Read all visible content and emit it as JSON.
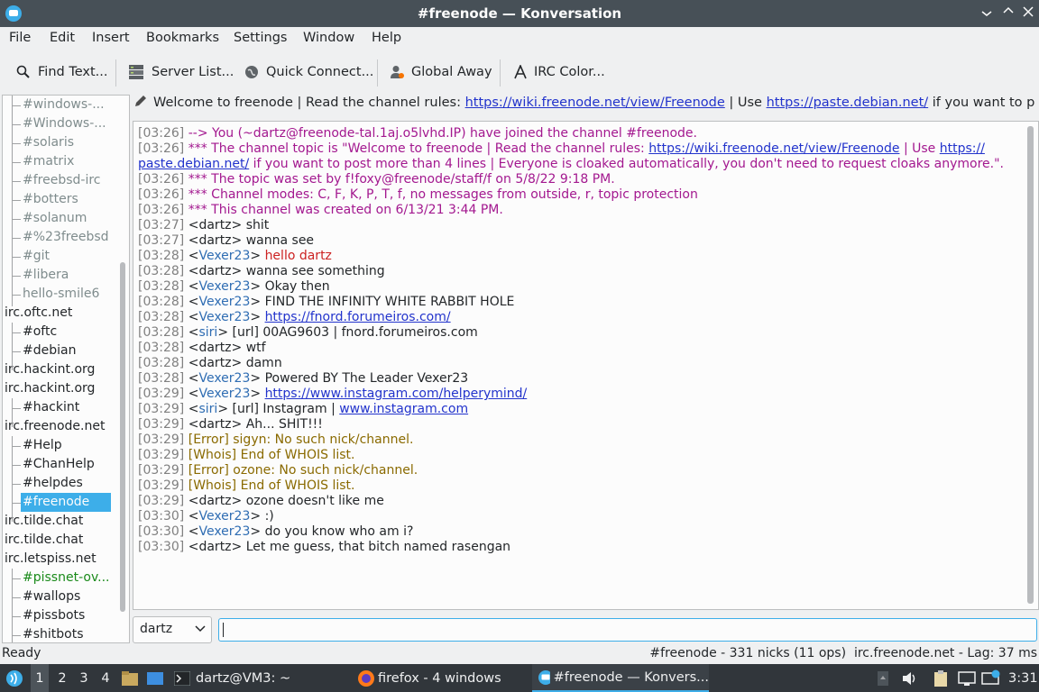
{
  "window": {
    "title": "#freenode — Konversation"
  },
  "menu": [
    "File",
    "Edit",
    "Insert",
    "Bookmarks",
    "Settings",
    "Window",
    "Help"
  ],
  "toolbar": {
    "find": "Find Text...",
    "server_list": "Server List...",
    "quick_connect": "Quick Connect...",
    "global_away": "Global Away",
    "irc_color": "IRC Color..."
  },
  "tree": [
    {
      "label": "#windows-...",
      "type": "channel",
      "color": "#7f8c8d"
    },
    {
      "label": "#Windows-...",
      "type": "channel",
      "color": "#7f8c8d"
    },
    {
      "label": "#solaris",
      "type": "channel",
      "color": "#7f8c8d"
    },
    {
      "label": "#matrix",
      "type": "channel",
      "color": "#7f8c8d"
    },
    {
      "label": "#freebsd-irc",
      "type": "channel",
      "color": "#7f8c8d"
    },
    {
      "label": "#botters",
      "type": "channel",
      "color": "#7f8c8d"
    },
    {
      "label": "#solanum",
      "type": "channel",
      "color": "#7f8c8d"
    },
    {
      "label": "#%23freebsd",
      "type": "channel",
      "color": "#7f8c8d"
    },
    {
      "label": "#git",
      "type": "channel",
      "color": "#7f8c8d"
    },
    {
      "label": "#libera",
      "type": "channel",
      "color": "#7f8c8d"
    },
    {
      "label": "hello-smile6",
      "type": "channel",
      "color": "#7f8c8d"
    },
    {
      "label": "irc.oftc.net",
      "type": "server",
      "color": "#232629"
    },
    {
      "label": "#oftc",
      "type": "channel",
      "color": "#232629"
    },
    {
      "label": "#debian",
      "type": "channel",
      "color": "#232629"
    },
    {
      "label": "irc.hackint.org",
      "type": "server",
      "color": "#232629"
    },
    {
      "label": "irc.hackint.org",
      "type": "server",
      "color": "#232629"
    },
    {
      "label": "#hackint",
      "type": "channel",
      "color": "#232629"
    },
    {
      "label": "irc.freenode.net",
      "type": "server",
      "color": "#232629"
    },
    {
      "label": "#Help",
      "type": "channel",
      "color": "#232629"
    },
    {
      "label": "#ChanHelp",
      "type": "channel",
      "color": "#232629"
    },
    {
      "label": "#helpdes",
      "type": "channel",
      "color": "#232629"
    },
    {
      "label": "#freenode",
      "type": "channel",
      "color": "#232629",
      "selected": true
    },
    {
      "label": "irc.tilde.chat",
      "type": "server",
      "color": "#232629"
    },
    {
      "label": "irc.tilde.chat",
      "type": "server",
      "color": "#232629"
    },
    {
      "label": "irc.letspiss.net",
      "type": "server",
      "color": "#232629"
    },
    {
      "label": "#pissnet-ov...",
      "type": "channel",
      "color": "#1a8a1a"
    },
    {
      "label": "#wallops",
      "type": "channel",
      "color": "#232629"
    },
    {
      "label": "#pissbots",
      "type": "channel",
      "color": "#232629"
    },
    {
      "label": "#shitbots",
      "type": "channel",
      "color": "#232629"
    }
  ],
  "topic": {
    "prefix": "Welcome to freenode | Read the channel rules: ",
    "link1": "https://wiki.freenode.net/view/Freenode",
    "mid": " | Use ",
    "link2": "https://paste.debian.net/",
    "suffix": " if you want to post ..."
  },
  "colors": {
    "system": "#a3188f",
    "nick": "#2f6db3",
    "siri": "#2f6db3",
    "error": "#8a6a00",
    "hello": "#cc2222",
    "link": "#2233cc",
    "selected": "#3daee9"
  },
  "chat": [
    {
      "ts": "[03:26]",
      "type": "system",
      "text": "--> You (~dartz@freenode-tal.1aj.o5lvhd.IP) have joined the channel #freenode."
    },
    {
      "ts": "[03:26]",
      "type": "system",
      "text": "*** The channel topic is \"Welcome to freenode | Read the channel rules: ",
      "link": "https://wiki.freenode.net/view/Freenode",
      "text2": "  | Use ",
      "link2": "https://"
    },
    {
      "ts": "",
      "type": "system_cont",
      "link": "paste.debian.net/",
      "text": " if you want to post more than 4 lines | Everyone is cloaked automatically, you don't need to request cloaks anymore.\"."
    },
    {
      "ts": "[03:26]",
      "type": "system",
      "text": "*** The topic was set by f!foxy@freenode/staff/f on 5/8/22 9:18 PM."
    },
    {
      "ts": "[03:26]",
      "type": "system",
      "text": "*** Channel modes: C, F, K, P, T, f, no messages from outside, r, topic protection"
    },
    {
      "ts": "[03:26]",
      "type": "system",
      "text": "*** This channel was created on 6/13/21 3:44 PM."
    },
    {
      "ts": "[03:27]",
      "type": "msg",
      "nick": "dartz",
      "own": true,
      "text": "shit"
    },
    {
      "ts": "[03:27]",
      "type": "msg",
      "nick": "dartz",
      "own": true,
      "text": "wanna see"
    },
    {
      "ts": "[03:28]",
      "type": "msg",
      "nick": "Vexer23",
      "text": "hello dartz",
      "highlight": true
    },
    {
      "ts": "[03:28]",
      "type": "msg",
      "nick": "dartz",
      "own": true,
      "text": "wanna see something"
    },
    {
      "ts": "[03:28]",
      "type": "msg",
      "nick": "Vexer23",
      "text": "Okay then"
    },
    {
      "ts": "[03:28]",
      "type": "msg",
      "nick": "Vexer23",
      "text": "FIND THE INFINITY WHITE RABBIT HOLE"
    },
    {
      "ts": "[03:28]",
      "type": "msg",
      "nick": "Vexer23",
      "link": "https://fnord.forumeiros.com/"
    },
    {
      "ts": "[03:28]",
      "type": "msg",
      "nick": "siri",
      "text": "[url] 00AG9603 | fnord.forumeiros.com"
    },
    {
      "ts": "[03:28]",
      "type": "msg",
      "nick": "dartz",
      "own": true,
      "text": "wtf"
    },
    {
      "ts": "[03:28]",
      "type": "msg",
      "nick": "dartz",
      "own": true,
      "text": "damn"
    },
    {
      "ts": "[03:28]",
      "type": "msg",
      "nick": "Vexer23",
      "text": "Powered BY The Leader Vexer23"
    },
    {
      "ts": "[03:29]",
      "type": "msg",
      "nick": "Vexer23",
      "link": "https://www.instagram.com/helperymind/"
    },
    {
      "ts": "[03:29]",
      "type": "msg",
      "nick": "siri",
      "text": "[url] Instagram | ",
      "link": "www.instagram.com"
    },
    {
      "ts": "[03:29]",
      "type": "msg",
      "nick": "dartz",
      "own": true,
      "text": "Ah... SHIT!!!"
    },
    {
      "ts": "[03:29]",
      "type": "info",
      "tag": "Error",
      "text": "sigyn: No such nick/channel."
    },
    {
      "ts": "[03:29]",
      "type": "info",
      "tag": "Whois",
      "text": "End of WHOIS list."
    },
    {
      "ts": "[03:29]",
      "type": "info",
      "tag": "Error",
      "text": "ozone: No such nick/channel."
    },
    {
      "ts": "[03:29]",
      "type": "info",
      "tag": "Whois",
      "text": "End of WHOIS list."
    },
    {
      "ts": "[03:29]",
      "type": "msg",
      "nick": "dartz",
      "own": true,
      "text": "ozone doesn't like me"
    },
    {
      "ts": "[03:30]",
      "type": "msg",
      "nick": "Vexer23",
      "text": ":)"
    },
    {
      "ts": "[03:30]",
      "type": "msg",
      "nick": "Vexer23",
      "text": "do you know who am i?"
    },
    {
      "ts": "[03:30]",
      "type": "msg",
      "nick": "dartz",
      "own": true,
      "text": "Let me guess, that bitch named rasengan"
    }
  ],
  "input": {
    "nick": "dartz",
    "value": ""
  },
  "status": {
    "left": "Ready",
    "right": "#freenode - 331 nicks (11 ops)  irc.freenode.net - Lag: 37 ms"
  },
  "taskbar": {
    "desktops": [
      "1",
      "2",
      "3",
      "4"
    ],
    "terminal": "dartz@VM3: ~",
    "firefox": "firefox - 4 windows",
    "konversation": "#freenode — Konvers...",
    "clock": "3:31"
  }
}
